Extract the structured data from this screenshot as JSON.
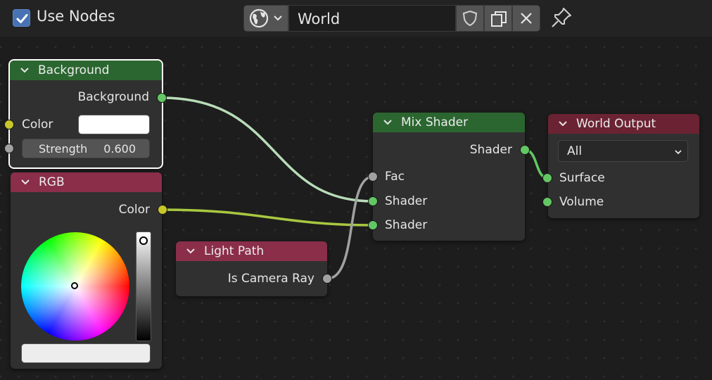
{
  "header": {
    "use_nodes_checked": true,
    "use_nodes_label": "Use Nodes",
    "world_name": "World"
  },
  "nodes": {
    "background": {
      "title": "Background",
      "output": "Background",
      "color_label": "Color",
      "color_value": "#ffffff",
      "strength_label": "Strength",
      "strength_value": "0.600"
    },
    "rgb": {
      "title": "RGB",
      "output": "Color",
      "color_value": "#ededed"
    },
    "light_path": {
      "title": "Light Path",
      "output": "Is Camera Ray"
    },
    "mix_shader": {
      "title": "Mix Shader",
      "output": "Shader",
      "inputs": [
        "Fac",
        "Shader",
        "Shader"
      ]
    },
    "world_output": {
      "title": "World Output",
      "target": "All",
      "inputs": [
        "Surface",
        "Volume"
      ]
    }
  },
  "colors": {
    "canvas": "#1d1d1d",
    "shader_socket": "#63c763",
    "color_socket": "#c7c729",
    "float_socket": "#a1a1a1",
    "shader_header": "#2b6630",
    "input_header": "#8a2e49",
    "output_header": "#6b2333",
    "accent": "#4772b3"
  }
}
